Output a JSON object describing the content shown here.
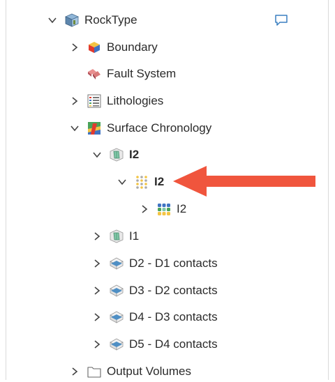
{
  "tree": {
    "rocktype": {
      "label": "RockType",
      "icon": "geological-model-icon"
    },
    "boundary": {
      "label": "Boundary",
      "icon": "boundary-icon"
    },
    "fault_system": {
      "label": "Fault System",
      "icon": "fault-system-icon"
    },
    "lithologies": {
      "label": "Lithologies",
      "icon": "lithologies-icon"
    },
    "surface_chronology": {
      "label": "Surface Chronology",
      "icon": "surface-chronology-icon"
    },
    "i2_volume": {
      "label": "I2",
      "icon": "intrusion-volume-icon"
    },
    "i2_points": {
      "label": "I2",
      "icon": "points-icon"
    },
    "i2_values": {
      "label": "I2",
      "icon": "values-icon"
    },
    "i1_volume": {
      "label": "I1",
      "icon": "intrusion-volume-icon"
    },
    "d2_d1": {
      "label": "D2 - D1 contacts",
      "icon": "contact-surface-icon"
    },
    "d3_d2": {
      "label": "D3 - D2 contacts",
      "icon": "contact-surface-icon"
    },
    "d4_d3": {
      "label": "D4 - D3 contacts",
      "icon": "contact-surface-icon"
    },
    "d5_d4": {
      "label": "D5 - D4 contacts",
      "icon": "contact-surface-icon"
    },
    "output_volumes": {
      "label": "Output Volumes",
      "icon": "folder-icon"
    }
  },
  "colors": {
    "arrow": "#f0553d",
    "comment": "#3a7fc0"
  }
}
